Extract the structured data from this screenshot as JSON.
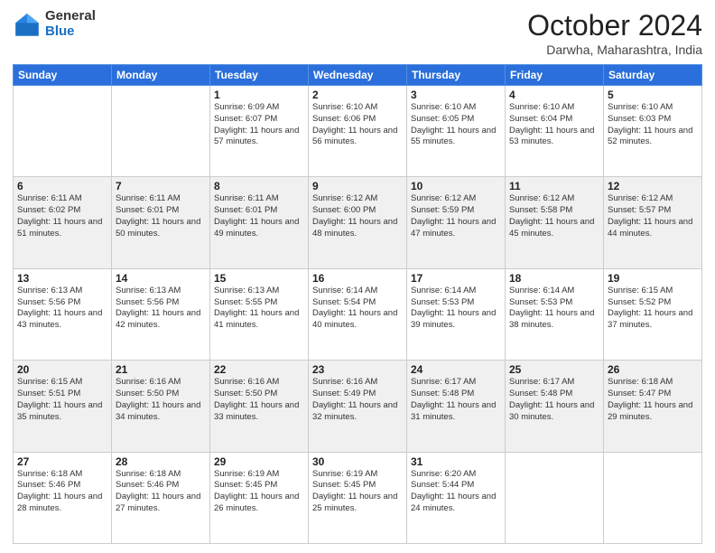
{
  "logo": {
    "general": "General",
    "blue": "Blue"
  },
  "header": {
    "month": "October 2024",
    "location": "Darwha, Maharashtra, India"
  },
  "weekdays": [
    "Sunday",
    "Monday",
    "Tuesday",
    "Wednesday",
    "Thursday",
    "Friday",
    "Saturday"
  ],
  "weeks": [
    [
      {
        "day": "",
        "sunrise": "",
        "sunset": "",
        "daylight": ""
      },
      {
        "day": "",
        "sunrise": "",
        "sunset": "",
        "daylight": ""
      },
      {
        "day": "1",
        "sunrise": "Sunrise: 6:09 AM",
        "sunset": "Sunset: 6:07 PM",
        "daylight": "Daylight: 11 hours and 57 minutes."
      },
      {
        "day": "2",
        "sunrise": "Sunrise: 6:10 AM",
        "sunset": "Sunset: 6:06 PM",
        "daylight": "Daylight: 11 hours and 56 minutes."
      },
      {
        "day": "3",
        "sunrise": "Sunrise: 6:10 AM",
        "sunset": "Sunset: 6:05 PM",
        "daylight": "Daylight: 11 hours and 55 minutes."
      },
      {
        "day": "4",
        "sunrise": "Sunrise: 6:10 AM",
        "sunset": "Sunset: 6:04 PM",
        "daylight": "Daylight: 11 hours and 53 minutes."
      },
      {
        "day": "5",
        "sunrise": "Sunrise: 6:10 AM",
        "sunset": "Sunset: 6:03 PM",
        "daylight": "Daylight: 11 hours and 52 minutes."
      }
    ],
    [
      {
        "day": "6",
        "sunrise": "Sunrise: 6:11 AM",
        "sunset": "Sunset: 6:02 PM",
        "daylight": "Daylight: 11 hours and 51 minutes."
      },
      {
        "day": "7",
        "sunrise": "Sunrise: 6:11 AM",
        "sunset": "Sunset: 6:01 PM",
        "daylight": "Daylight: 11 hours and 50 minutes."
      },
      {
        "day": "8",
        "sunrise": "Sunrise: 6:11 AM",
        "sunset": "Sunset: 6:01 PM",
        "daylight": "Daylight: 11 hours and 49 minutes."
      },
      {
        "day": "9",
        "sunrise": "Sunrise: 6:12 AM",
        "sunset": "Sunset: 6:00 PM",
        "daylight": "Daylight: 11 hours and 48 minutes."
      },
      {
        "day": "10",
        "sunrise": "Sunrise: 6:12 AM",
        "sunset": "Sunset: 5:59 PM",
        "daylight": "Daylight: 11 hours and 47 minutes."
      },
      {
        "day": "11",
        "sunrise": "Sunrise: 6:12 AM",
        "sunset": "Sunset: 5:58 PM",
        "daylight": "Daylight: 11 hours and 45 minutes."
      },
      {
        "day": "12",
        "sunrise": "Sunrise: 6:12 AM",
        "sunset": "Sunset: 5:57 PM",
        "daylight": "Daylight: 11 hours and 44 minutes."
      }
    ],
    [
      {
        "day": "13",
        "sunrise": "Sunrise: 6:13 AM",
        "sunset": "Sunset: 5:56 PM",
        "daylight": "Daylight: 11 hours and 43 minutes."
      },
      {
        "day": "14",
        "sunrise": "Sunrise: 6:13 AM",
        "sunset": "Sunset: 5:56 PM",
        "daylight": "Daylight: 11 hours and 42 minutes."
      },
      {
        "day": "15",
        "sunrise": "Sunrise: 6:13 AM",
        "sunset": "Sunset: 5:55 PM",
        "daylight": "Daylight: 11 hours and 41 minutes."
      },
      {
        "day": "16",
        "sunrise": "Sunrise: 6:14 AM",
        "sunset": "Sunset: 5:54 PM",
        "daylight": "Daylight: 11 hours and 40 minutes."
      },
      {
        "day": "17",
        "sunrise": "Sunrise: 6:14 AM",
        "sunset": "Sunset: 5:53 PM",
        "daylight": "Daylight: 11 hours and 39 minutes."
      },
      {
        "day": "18",
        "sunrise": "Sunrise: 6:14 AM",
        "sunset": "Sunset: 5:53 PM",
        "daylight": "Daylight: 11 hours and 38 minutes."
      },
      {
        "day": "19",
        "sunrise": "Sunrise: 6:15 AM",
        "sunset": "Sunset: 5:52 PM",
        "daylight": "Daylight: 11 hours and 37 minutes."
      }
    ],
    [
      {
        "day": "20",
        "sunrise": "Sunrise: 6:15 AM",
        "sunset": "Sunset: 5:51 PM",
        "daylight": "Daylight: 11 hours and 35 minutes."
      },
      {
        "day": "21",
        "sunrise": "Sunrise: 6:16 AM",
        "sunset": "Sunset: 5:50 PM",
        "daylight": "Daylight: 11 hours and 34 minutes."
      },
      {
        "day": "22",
        "sunrise": "Sunrise: 6:16 AM",
        "sunset": "Sunset: 5:50 PM",
        "daylight": "Daylight: 11 hours and 33 minutes."
      },
      {
        "day": "23",
        "sunrise": "Sunrise: 6:16 AM",
        "sunset": "Sunset: 5:49 PM",
        "daylight": "Daylight: 11 hours and 32 minutes."
      },
      {
        "day": "24",
        "sunrise": "Sunrise: 6:17 AM",
        "sunset": "Sunset: 5:48 PM",
        "daylight": "Daylight: 11 hours and 31 minutes."
      },
      {
        "day": "25",
        "sunrise": "Sunrise: 6:17 AM",
        "sunset": "Sunset: 5:48 PM",
        "daylight": "Daylight: 11 hours and 30 minutes."
      },
      {
        "day": "26",
        "sunrise": "Sunrise: 6:18 AM",
        "sunset": "Sunset: 5:47 PM",
        "daylight": "Daylight: 11 hours and 29 minutes."
      }
    ],
    [
      {
        "day": "27",
        "sunrise": "Sunrise: 6:18 AM",
        "sunset": "Sunset: 5:46 PM",
        "daylight": "Daylight: 11 hours and 28 minutes."
      },
      {
        "day": "28",
        "sunrise": "Sunrise: 6:18 AM",
        "sunset": "Sunset: 5:46 PM",
        "daylight": "Daylight: 11 hours and 27 minutes."
      },
      {
        "day": "29",
        "sunrise": "Sunrise: 6:19 AM",
        "sunset": "Sunset: 5:45 PM",
        "daylight": "Daylight: 11 hours and 26 minutes."
      },
      {
        "day": "30",
        "sunrise": "Sunrise: 6:19 AM",
        "sunset": "Sunset: 5:45 PM",
        "daylight": "Daylight: 11 hours and 25 minutes."
      },
      {
        "day": "31",
        "sunrise": "Sunrise: 6:20 AM",
        "sunset": "Sunset: 5:44 PM",
        "daylight": "Daylight: 11 hours and 24 minutes."
      },
      {
        "day": "",
        "sunrise": "",
        "sunset": "",
        "daylight": ""
      },
      {
        "day": "",
        "sunrise": "",
        "sunset": "",
        "daylight": ""
      }
    ]
  ]
}
